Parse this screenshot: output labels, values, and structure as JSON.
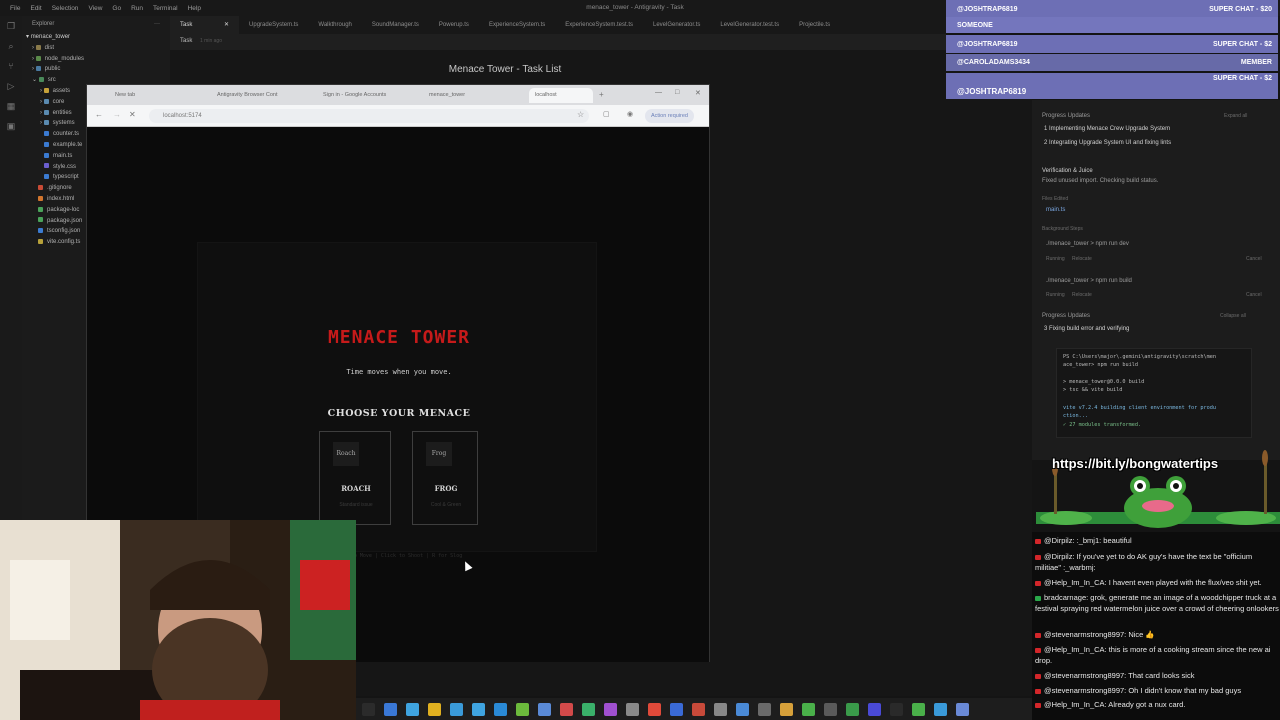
{
  "ide": {
    "menu": [
      "File",
      "Edit",
      "Selection",
      "View",
      "Go",
      "Run",
      "Terminal",
      "Help"
    ],
    "window_title": "menace_tower - Antigravity - Task",
    "explorer_title": "Explorer",
    "project": "menace_tower",
    "tree": [
      {
        "label": "dist",
        "depth": 1
      },
      {
        "label": "node_modules",
        "depth": 1
      },
      {
        "label": "public",
        "depth": 1
      },
      {
        "label": "src",
        "depth": 1
      },
      {
        "label": "assets",
        "depth": 2
      },
      {
        "label": "core",
        "depth": 2
      },
      {
        "label": "entities",
        "depth": 2
      },
      {
        "label": "systems",
        "depth": 2
      },
      {
        "label": "counter.ts",
        "depth": 2
      },
      {
        "label": "example.te",
        "depth": 2
      },
      {
        "label": "main.ts",
        "depth": 2
      },
      {
        "label": "style.css",
        "depth": 2
      },
      {
        "label": "typescript",
        "depth": 2
      },
      {
        "label": ".gitignore",
        "depth": 1
      },
      {
        "label": "index.html",
        "depth": 1
      },
      {
        "label": "package-loc",
        "depth": 1
      },
      {
        "label": "package.json",
        "depth": 1
      },
      {
        "label": "tsconfig.json",
        "depth": 1
      },
      {
        "label": "vite.config.ts",
        "depth": 1
      }
    ],
    "tabs": [
      "Task",
      "UpgradeSystem.ts",
      "Walkthrough",
      "SoundManager.ts",
      "Powerup.ts",
      "ExperienceSystem.ts",
      "ExperienceSystem.test.ts",
      "LevelGenerator.ts",
      "LevelGenerator.test.ts",
      "Projectile.ts"
    ],
    "task_label": "Task",
    "task_time": "1 min ago",
    "task_title": "Menace Tower - Task List"
  },
  "browser": {
    "tabs": [
      "New tab",
      "Antigravity Browser Cont",
      "Sign in - Google Accounts",
      "menace_tower",
      "localhost"
    ],
    "url": "localhost:5174",
    "action_label": "Action required"
  },
  "game": {
    "title": "MENACE TOWER",
    "subtitle": "Time moves when you move.",
    "choose": "CHOOSE YOUR MENACE",
    "cards": [
      {
        "img": "Roach",
        "name": "ROACH",
        "desc": "Standard issue"
      },
      {
        "img": "Frog",
        "name": "FROG",
        "desc": "Cool & Green"
      }
    ],
    "hint": "WASD to Move | Click to Shoot | R for Slog"
  },
  "agent": {
    "progress_header": "Progress Updates",
    "expand": "Expand all",
    "steps": [
      "Implementing Menace Crew Upgrade System",
      "Integrating Upgrade System UI and fixing lints"
    ],
    "verify_title": "Verification & Juice",
    "verify_text": "Fixed unused import. Checking build status.",
    "files_edited": "Files Edited",
    "file": "main.ts",
    "bg_steps": "Background Steps",
    "cmd1": "./menace_tower > npm run dev",
    "cmd2": "./menace_tower > npm run build",
    "running": "Running",
    "relocate": "Relocate",
    "cancel": "Cancel",
    "progress2": "Progress Updates",
    "collapse": "Collapse all",
    "step3": "Fixing build error and verifying",
    "term_lines": [
      "PS C:\\Users\\major\\.gemini\\antigravity\\scratch\\men",
      "ace_tower> npm run build",
      "> menace_tower@0.0.0 build",
      "> tsc && vite build",
      "vite v7.2.4 building client environment for produ",
      "ction...",
      "✓ 27 modules transformed."
    ]
  },
  "super_chats": [
    {
      "user": "@JOSHTRAP6819",
      "right": "SUPER CHAT - $20"
    },
    {
      "user": "SOMEONE",
      "right": ""
    },
    {
      "user": "@JOSHTRAP6819",
      "right": "SUPER CHAT - $2"
    },
    {
      "user": "@CAROLADAMS3434",
      "right": "MEMBER"
    },
    {
      "user": "@JOSHTRAP6819",
      "right": "SUPER CHAT - $2"
    }
  ],
  "banner": {
    "url": "https://bit.ly/bongwatertips"
  },
  "chat": [
    {
      "user": "@Dirpilz:",
      "text": " :_bmj1: beautiful"
    },
    {
      "user": "@Dirpilz:",
      "text": " If you've yet to do AK guy's have the text be \"officium militiae\" :_warbmj:"
    },
    {
      "user": "@Help_Im_In_CA:",
      "text": " I havent even played with the flux/veo shit yet."
    },
    {
      "user": "bradcarnage:",
      "text": " grok, generate me an image of a woodchipper truck at a festival spraying red watermelon juice over a crowd of cheering onlookers"
    },
    {
      "user": "@stevenarmstrong8997:",
      "text": " Nice 👍"
    },
    {
      "user": "@Help_Im_In_CA:",
      "text": " this is more of a cooking stream since the new ai drop."
    },
    {
      "user": "@stevenarmstrong8997:",
      "text": " That card looks sick"
    },
    {
      "user": "@stevenarmstrong8997:",
      "text": " Oh I didn't know that my bad guys"
    },
    {
      "user": "@Help_Im_In_CA:",
      "text": " Already got a nux card."
    }
  ],
  "colors": {
    "accent_red": "#c61a1a",
    "superchat": "#6d6fb5",
    "ide_bg": "#1b1b1b"
  }
}
